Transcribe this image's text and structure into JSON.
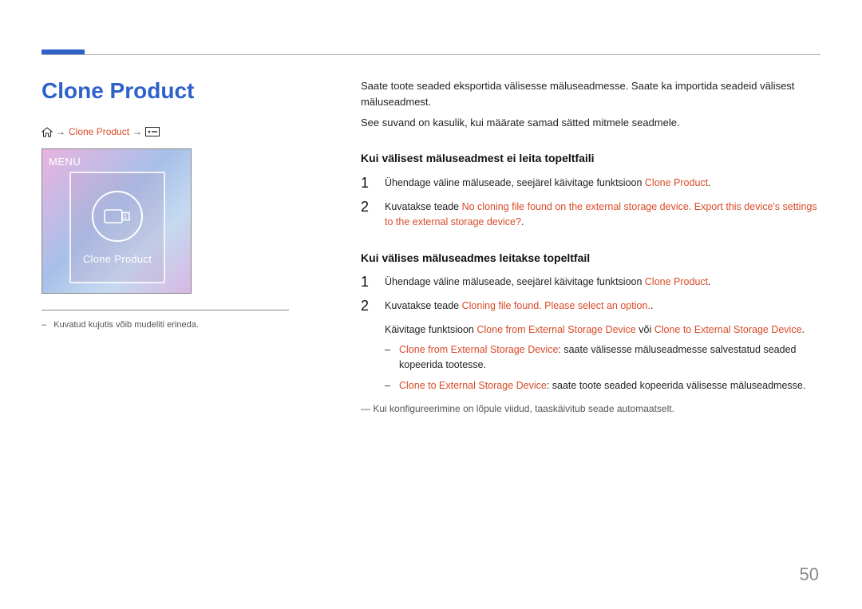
{
  "page": {
    "title": "Clone Product",
    "number": "50"
  },
  "breadcrumb": {
    "arrow": "→",
    "item": "Clone Product"
  },
  "screen": {
    "menu": "MENU",
    "card_caption": "Clone Product"
  },
  "left": {
    "img_note_dash": "–",
    "img_note": "Kuvatud kujutis võib mudeliti erineda."
  },
  "intro": {
    "p1": "Saate toote seaded eksportida välisesse mäluseadmesse. Saate ka importida seadeid välisest mäluseadmest.",
    "p2": "See suvand on kasulik, kui määrate samad sätted mitmele seadmele."
  },
  "sec1": {
    "heading": "Kui välisest mäluseadmest ei leita topeltfaili",
    "s1": {
      "num": "1",
      "a": "Ühendage väline mäluseade, seejärel käivitage funktsioon ",
      "b": "Clone Product",
      "c": "."
    },
    "s2": {
      "num": "2",
      "a": "Kuvatakse teade ",
      "b": "No cloning file found on the external storage device. Export this device's settings to the external storage device?",
      "c": "."
    }
  },
  "sec2": {
    "heading": "Kui välises mäluseadmes leitakse topeltfail",
    "s1": {
      "num": "1",
      "a": "Ühendage väline mäluseade, seejärel käivitage funktsioon ",
      "b": "Clone Product",
      "c": "."
    },
    "s2": {
      "num": "2",
      "a": "Kuvatakse teade ",
      "b": "Cloning file found. Please select an option.",
      "c": ".",
      "d1": "Käivitage funktsioon ",
      "d2": "Clone from External Storage Device",
      "d3": " või ",
      "d4": "Clone to External Storage Device",
      "d5": ".",
      "b1": {
        "dash": "–",
        "k": "Clone from External Storage Device",
        "t": ": saate välisesse mäluseadmesse salvestatud seaded kopeerida tootesse."
      },
      "b2": {
        "dash": "–",
        "k": "Clone to External Storage Device",
        "t": ": saate toote seaded kopeerida välisesse mäluseadmesse."
      }
    },
    "footnote_dash": "―",
    "footnote": "Kui konfigureerimine on lõpule viidud, taaskäivitub seade automaatselt."
  }
}
